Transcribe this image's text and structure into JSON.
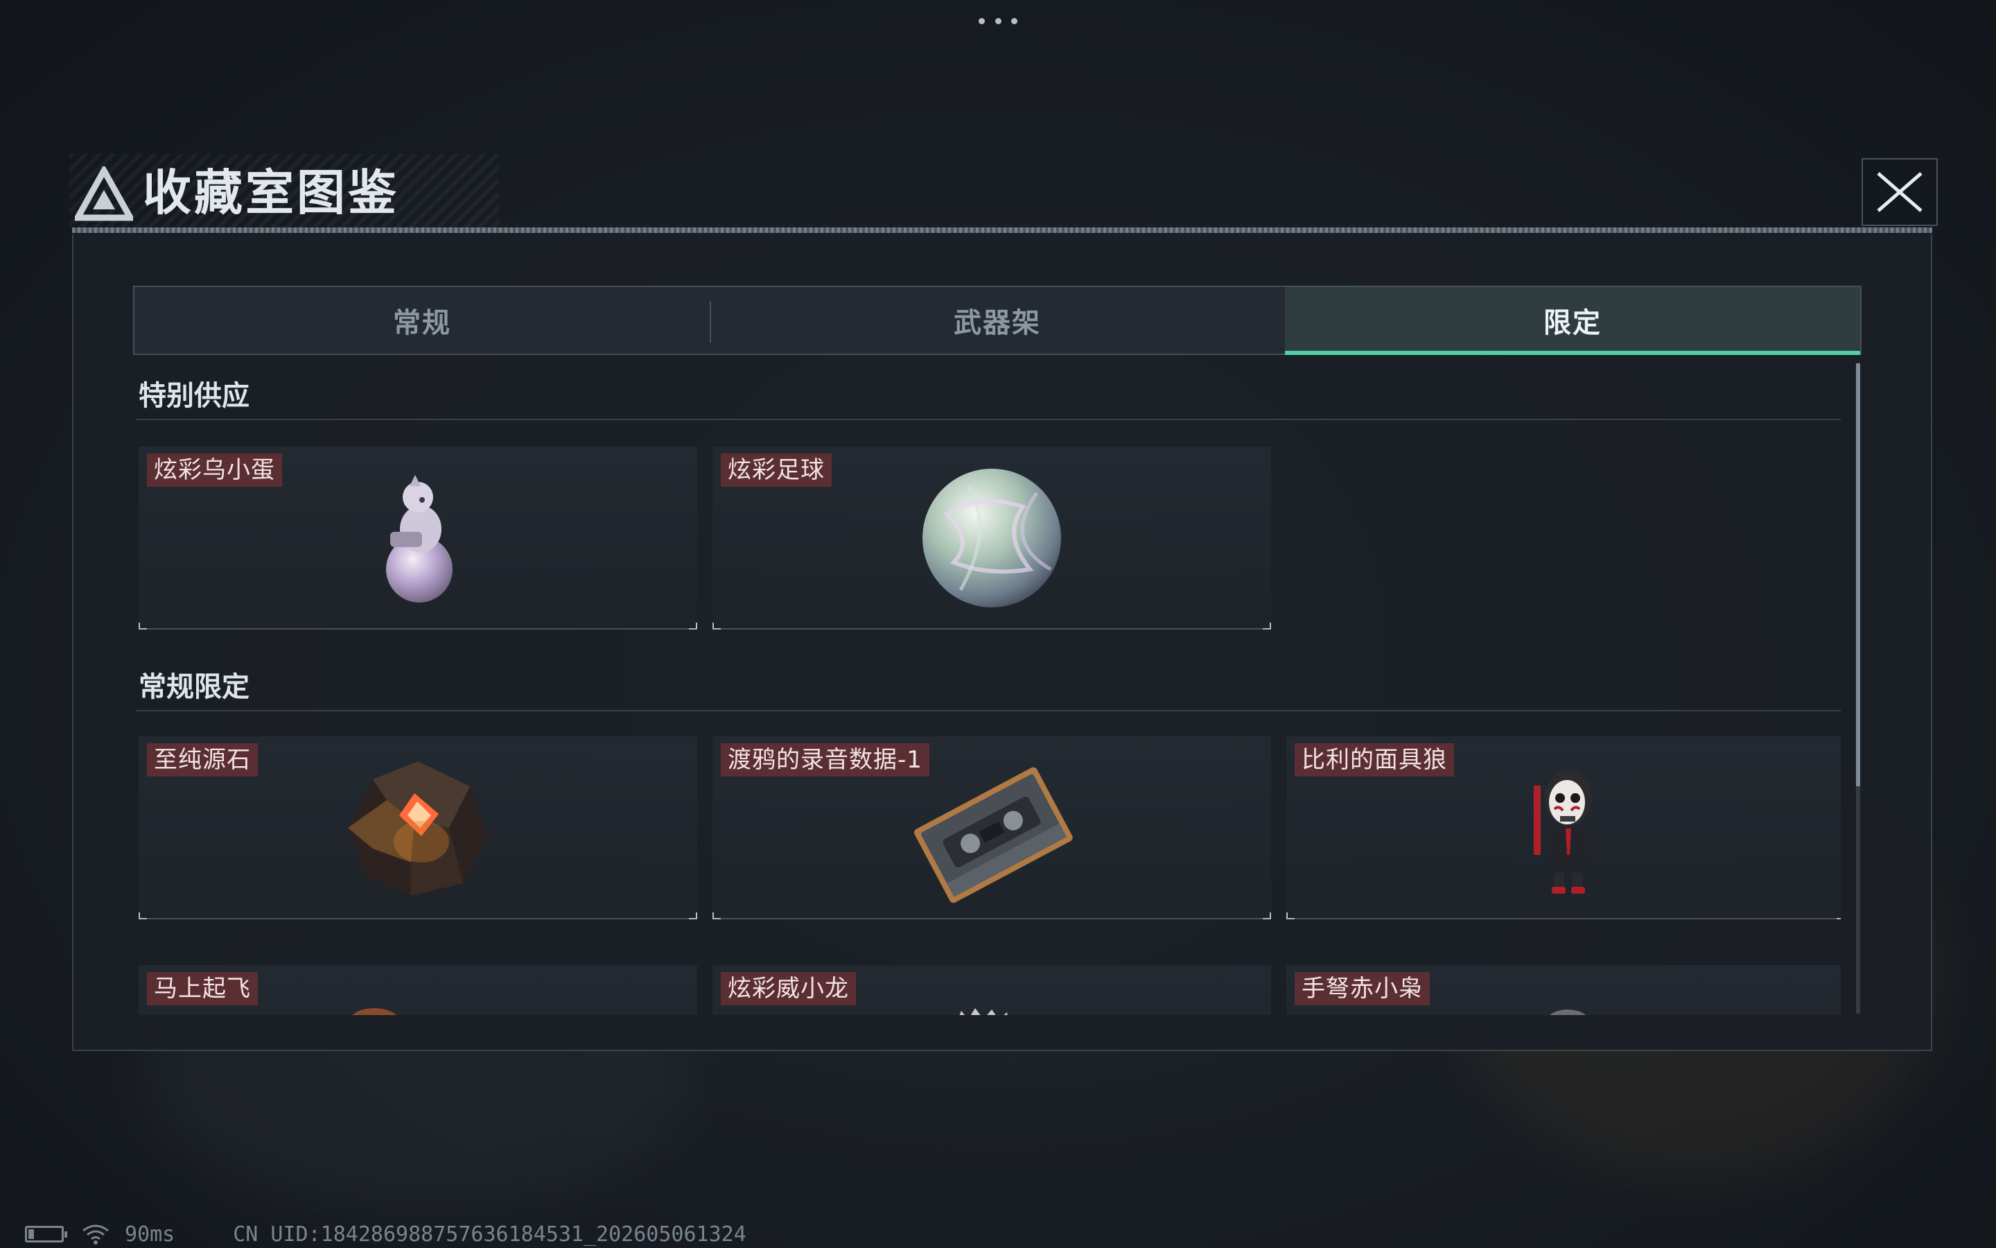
{
  "header": {
    "title": "收藏室图鉴",
    "close_icon": "close-icon"
  },
  "tabs": [
    {
      "label": "常规",
      "active": false
    },
    {
      "label": "武器架",
      "active": false
    },
    {
      "label": "限定",
      "active": true
    }
  ],
  "colors": {
    "accent": "#4fd1a1",
    "label_bg": "#5b2e33",
    "panel_bg": "#1b2026"
  },
  "sections": [
    {
      "title": "特别供应",
      "items": [
        {
          "label": "炫彩乌小蛋",
          "icon": "iridescent-egg-figure-icon"
        },
        {
          "label": "炫彩足球",
          "icon": "iridescent-soccer-ball-icon"
        }
      ]
    },
    {
      "title": "常规限定",
      "items": [
        {
          "label": "至纯源石",
          "icon": "glowing-crystal-stone-icon"
        },
        {
          "label": "渡鸦的录音数据-1",
          "icon": "cassette-tape-icon"
        },
        {
          "label": "比利的面具狼",
          "icon": "billy-puppet-figure-icon"
        },
        {
          "label": "马上起飞",
          "icon": "item-icon"
        },
        {
          "label": "炫彩威小龙",
          "icon": "item-icon"
        },
        {
          "label": "手弩赤小枭",
          "icon": "item-icon"
        }
      ]
    }
  ],
  "status_bar": {
    "ping": "90ms",
    "uid": "CN UID:18428698875763618453​1_202605061324"
  },
  "scroll": {
    "thumb_fraction": 0.65
  }
}
